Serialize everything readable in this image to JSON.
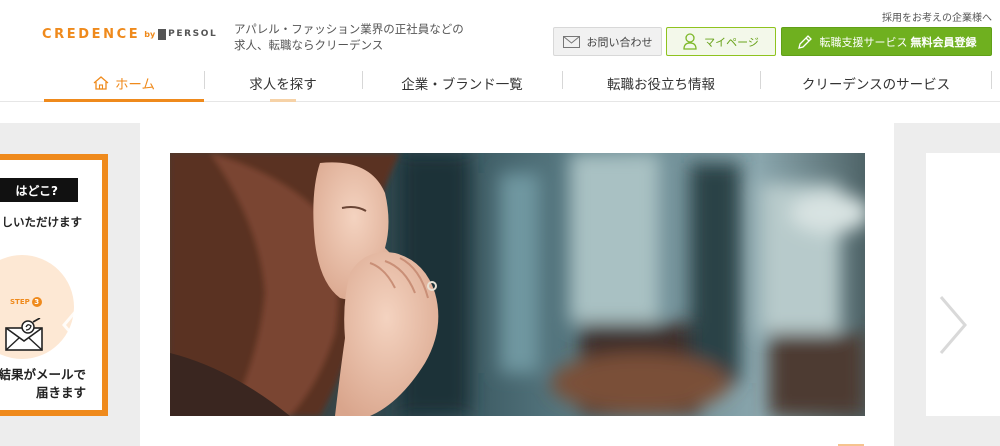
{
  "header": {
    "logo": {
      "brand": "CREDENCE",
      "by": "by",
      "partner": "PERSOL"
    },
    "tagline_line1": "アパレル・ファッション業界の正社員などの",
    "tagline_line2": "求人、転職ならクリーデンス",
    "corp_link": "採用をお考えの企業様へ",
    "contact_button": "お問い合わせ",
    "mypage_button": "マイページ",
    "register_button_prefix": "転職支援サービス",
    "register_button_strong": "無料会員登録"
  },
  "nav": {
    "items": [
      {
        "label": "ホーム",
        "icon": "home-icon"
      },
      {
        "label": "求人を探す"
      },
      {
        "label": "企業・ブランド一覧"
      },
      {
        "label": "転職お役立ち情報"
      },
      {
        "label": "クリーデンスのサービス"
      }
    ]
  },
  "carousel": {
    "left_slide": {
      "heading": "はどこ?",
      "subtext": "しいただけます",
      "step_label": "STEP",
      "step_number": "3",
      "result_line1": "結果がメールで",
      "result_line2": "届きます",
      "icon": "mail-icon"
    },
    "main_slide": {
      "icon": "photo-woman-praying"
    },
    "prev_icon": "chevron-left-icon",
    "next_icon": "chevron-right-icon"
  },
  "colors": {
    "brand_orange": "#ef8a1c",
    "brand_green": "#6fb01f",
    "light_green_border": "#8fc31f"
  }
}
